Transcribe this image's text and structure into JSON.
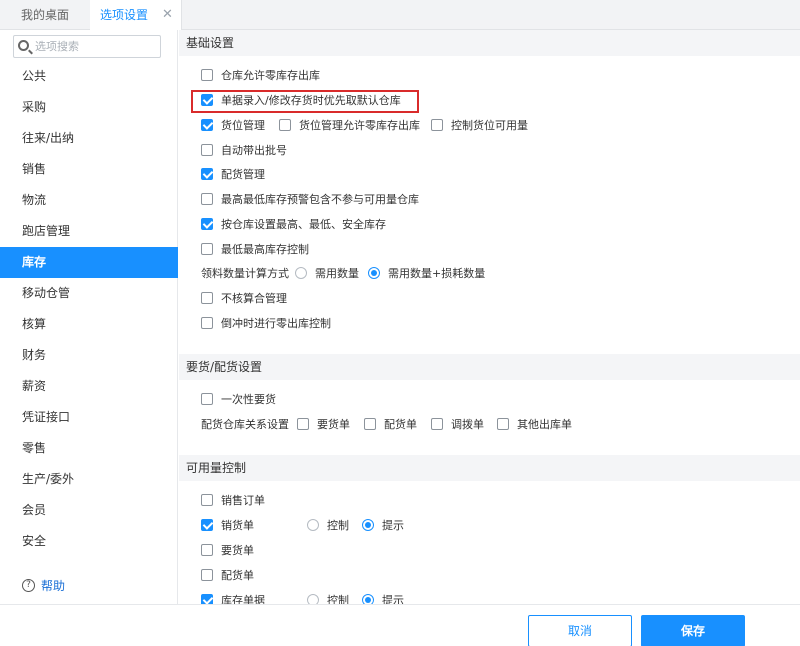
{
  "tabs": [
    {
      "label": "我的桌面",
      "active": false
    },
    {
      "label": "选项设置",
      "active": true,
      "closable": true
    }
  ],
  "tab_close_glyph": "✕",
  "search": {
    "placeholder": "选项搜索",
    "value": ""
  },
  "sidebar": {
    "items": [
      {
        "label": "公共"
      },
      {
        "label": "采购"
      },
      {
        "label": "往来/出纳"
      },
      {
        "label": "销售"
      },
      {
        "label": "物流"
      },
      {
        "label": "跑店管理"
      },
      {
        "label": "库存",
        "active": true
      },
      {
        "label": "移动仓管"
      },
      {
        "label": "核算"
      },
      {
        "label": "财务"
      },
      {
        "label": "薪资"
      },
      {
        "label": "凭证接口"
      },
      {
        "label": "零售"
      },
      {
        "label": "生产/委外"
      },
      {
        "label": "会员"
      },
      {
        "label": "安全"
      }
    ],
    "help_label": "帮助"
  },
  "sections": {
    "basic": {
      "title": "基础设置",
      "rows": {
        "r1": {
          "label": "仓库允许零库存出库",
          "checked": false
        },
        "r2": {
          "label": "单据录入/修改存货时优先取默认仓库",
          "checked": true,
          "highlighted": true
        },
        "r3a": {
          "label": "货位管理",
          "checked": true
        },
        "r3b": {
          "label": "货位管理允许零库存出库",
          "checked": false
        },
        "r3c": {
          "label": "控制货位可用量",
          "checked": false
        },
        "r4": {
          "label": "自动带出批号",
          "checked": false
        },
        "r5": {
          "label": "配货管理",
          "checked": true
        },
        "r6": {
          "label": "最高最低库存预警包含不参与可用量仓库",
          "checked": false
        },
        "r7": {
          "label": "按仓库设置最高、最低、安全库存",
          "checked": true
        },
        "r8": {
          "label": "最低最高库存控制",
          "checked": false
        },
        "r9": {
          "label": "领料数量计算方式",
          "opt1": "需用数量",
          "opt2": "需用数量+损耗数量",
          "selected": "需用数量+损耗数量"
        },
        "r10": {
          "label": "不核算合管理",
          "checked": false
        },
        "r11": {
          "label": "倒冲时进行零出库控制",
          "checked": false
        }
      }
    },
    "delivery": {
      "title": "要货/配货设置",
      "rows": {
        "r1": {
          "label": "一次性要货",
          "checked": false
        },
        "r2": {
          "label": "配货仓库关系设置",
          "c1": "要货单",
          "c2": "配货单",
          "c3": "调拨单",
          "c4": "其他出库单"
        }
      }
    },
    "availability": {
      "title": "可用量控制",
      "rows": {
        "r1": {
          "label": "销售订单",
          "checked": false
        },
        "r2": {
          "label": "销货单",
          "checked": true,
          "opt1": "控制",
          "opt2": "提示",
          "selected": "提示"
        },
        "r3": {
          "label": "要货单",
          "checked": false
        },
        "r4": {
          "label": "配货单",
          "checked": false
        },
        "r5": {
          "label": "库存单据",
          "checked": true,
          "opt1": "控制",
          "opt2": "提示",
          "selected": "提示"
        }
      }
    }
  },
  "footer": {
    "cancel_label": "取消",
    "save_label": "保存"
  },
  "colors": {
    "accent": "#1890ff",
    "highlight_border": "#d92b2b",
    "link": "#1a6fd6"
  },
  "icons": {
    "search": "search-icon",
    "help": "help-icon",
    "close": "close-icon",
    "checkmark": "check-icon"
  }
}
